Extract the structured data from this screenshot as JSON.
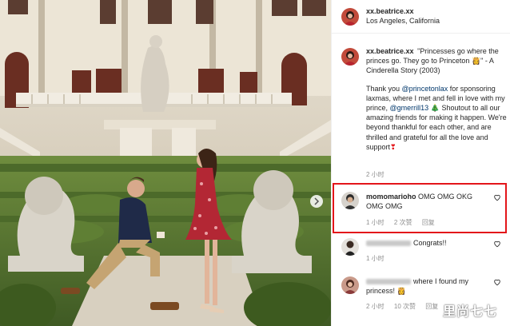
{
  "post": {
    "username": "xx.beatrice.xx",
    "location": "Los Angeles, California",
    "caption": {
      "quote": "\"Princesses go where the princes go. They go to Princeton",
      "quote_end": "\" - A Cinderella Story (2003)",
      "thanks_prefix": "Thank you",
      "mention1": "@princetonlax",
      "thanks_mid": "for sponsoring laxmas, where I met and fell in love with my prince,",
      "mention2": "@gmerrill13",
      "thanks_end": "Shoutout to all our amazing friends for making it happen. We're beyond thankful for each other, and are thrilled and grateful for all the love and support",
      "time": "2 小时"
    }
  },
  "comments": [
    {
      "username": "momomarioho",
      "text": "OMG OMG OKG OMG OMG",
      "time": "1 小时",
      "likes": "2 次赞",
      "reply": "回复"
    },
    {
      "username": "",
      "text": "Congrats!!",
      "time": "1 小时",
      "likes": "",
      "reply": ""
    },
    {
      "username": "",
      "text": "where I found my princess!",
      "time": "2 小时",
      "likes": "10 次赞",
      "reply": "回复"
    }
  ],
  "watermark": "里尚七七",
  "colors": {
    "highlight": "#e3151a",
    "link": "#00376b",
    "muted": "#8e8e8e"
  },
  "icons": [
    "heart-icon",
    "princess-emoji-icon",
    "tree-emoji-icon",
    "heart-exclamation-emoji-icon"
  ]
}
